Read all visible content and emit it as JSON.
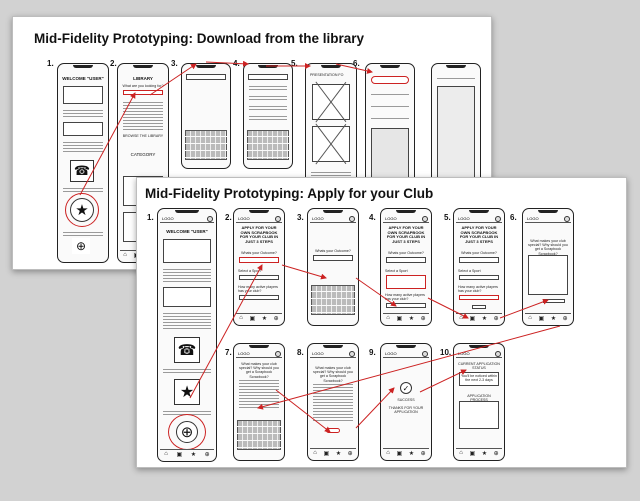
{
  "sheet1": {
    "title": "Mid-Fidelity Prototyping:  Download from the library",
    "steps": [
      "1.",
      "2.",
      "3.",
      "4.",
      "5.",
      "6."
    ],
    "welcome": "WELCOME \"USER\"",
    "library_title": "LIBRARY",
    "library_question": "What are you looking for?",
    "browse_label": "BROWSE THE LIBRARY",
    "category_label": "CATEGORY",
    "presentation_label": "PRESENTATION FO",
    "logo": "LOGO"
  },
  "sheet2": {
    "title": "Mid-Fidelity Prototyping: Apply for your Club",
    "steps": [
      "1.",
      "2.",
      "3.",
      "4.",
      "5.",
      "6.",
      "7.",
      "8.",
      "9.",
      "10."
    ],
    "logo": "LOGO",
    "welcome": "WELCOME \"USER\"",
    "apply_heading": "APPLY FOR YOUR OWN SCRAPBOOK FOR YOUR CLUB IN JUST 3 STEPS",
    "whats_outcome": "Whats your Outcome?",
    "select_sport": "Select a Sport",
    "how_many": "How many active players has your club?",
    "what_makes": "What makes your club special? Why should you get a Scrapbook Scrapbook?",
    "success": "SUCCESS",
    "thanks": "THANKS FOR YOUR APPLICATION",
    "current_status": "CURRENT APPLICATION STATUS",
    "not_yet": "You'll be noticed within the next 2-3 days",
    "app_process": "APPLICATION PROCESS"
  }
}
